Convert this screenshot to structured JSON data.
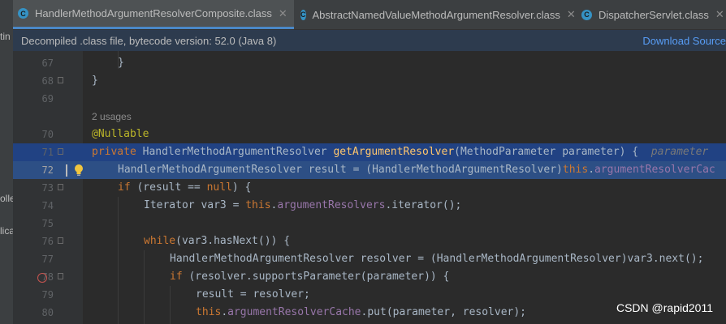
{
  "left_strip": {
    "fragments": [
      "tin",
      "olle",
      "lica"
    ]
  },
  "tabs": [
    {
      "label": "HandlerMethodArgumentResolverComposite.class",
      "icon": "class-file-icon",
      "active": true
    },
    {
      "label": "AbstractNamedValueMethodArgumentResolver.class",
      "icon": "class-file-icon",
      "active": false
    },
    {
      "label": "DispatcherServlet.class",
      "icon": "class-file-icon",
      "active": false
    }
  ],
  "banner": {
    "message": "Decompiled .class file, bytecode version: 52.0 (Java 8)",
    "download_link": "Download Source"
  },
  "editor": {
    "usages_hint": "2 usages",
    "line_numbers": [
      "67",
      "68",
      "69",
      "70",
      "71",
      "72",
      "73",
      "74",
      "75",
      "76",
      "77",
      "78",
      "79",
      "80"
    ],
    "lines": {
      "l67_brace": "}",
      "l68_brace": "}",
      "l70_annotation": "@Nullable",
      "l71_private": "private",
      "l71_type": "HandlerMethodArgumentResolver",
      "l71_method": "getArgumentResolver",
      "l71_params": "(MethodParameter parameter) {",
      "l71_hint": "parameter",
      "l72_decl": "HandlerMethodArgumentResolver result = (HandlerMethodArgumentResolver)",
      "l72_this": "this",
      "l72_field": "argumentResolverCac",
      "l73_if": "if",
      "l73_cond": "(result ==",
      "l73_null": "null",
      "l73_end": ") {",
      "l74_decl": "Iterator var3 =",
      "l74_this": "this",
      "l74_field": "argumentResolvers",
      "l74_call": ".iterator();",
      "l76_while": "while",
      "l76_cond": "(var3.hasNext()) {",
      "l77_stmt": "HandlerMethodArgumentResolver resolver = (HandlerMethodArgumentResolver)var3.next();",
      "l78_if": "if",
      "l78_cond": "(resolver.supportsParameter(parameter)) {",
      "l79_stmt": "result = resolver;",
      "l80_this": "this",
      "l80_field": "argumentResolverCache",
      "l80_call": ".put(parameter, resolver);"
    }
  },
  "watermark": "CSDN @rapid2011",
  "colors": {
    "keyword": "#cc7832",
    "method": "#ffc66d",
    "field": "#9876aa",
    "annotation": "#bbb529",
    "selection": "#214283",
    "tab_underline": "#4a88c7",
    "breakpoint": "#c75450",
    "link": "#589df6"
  }
}
